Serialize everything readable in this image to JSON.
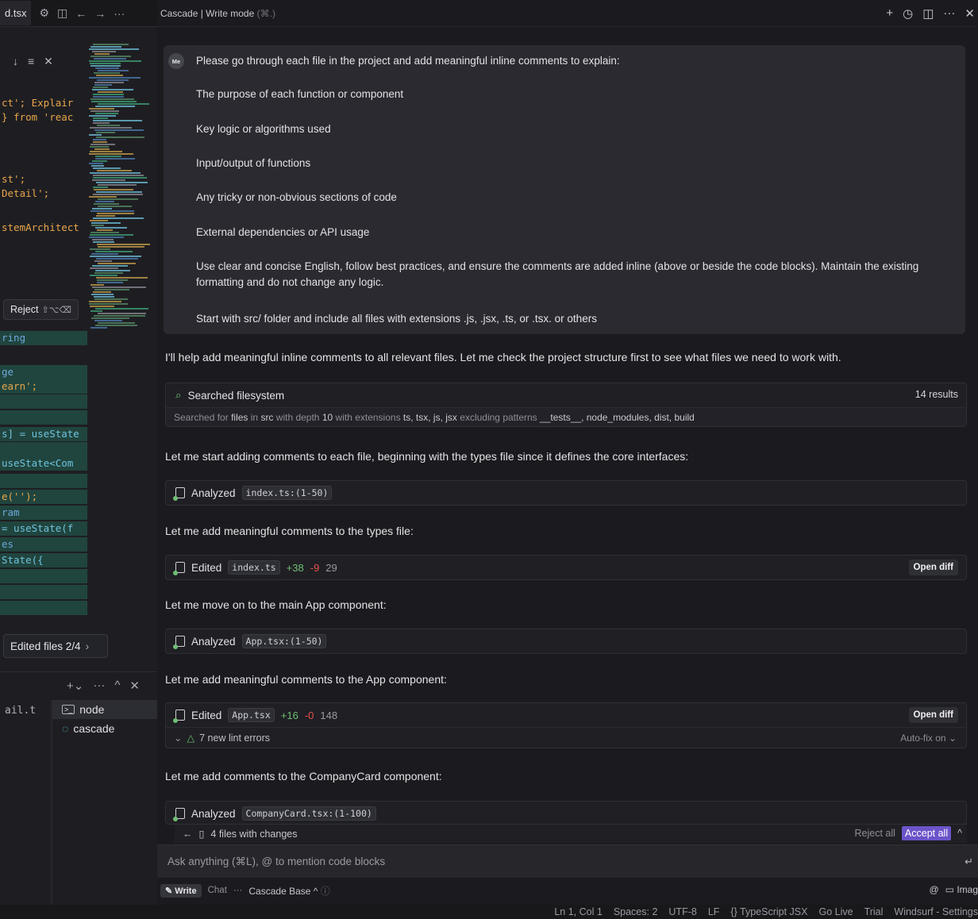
{
  "left_editor": {
    "tab_name": "d.tsx",
    "code_fragments": [
      {
        "text": "ct';  Explair",
        "color": "#e8a64a"
      },
      {
        "text": " } from 'reac",
        "color": "#e8a64a"
      },
      {
        "text": "st';",
        "color": "#e8a64a"
      },
      {
        "text": "Detail';",
        "color": "#e8a64a"
      },
      {
        "text": "stemArchitect",
        "color": "#e8a64a"
      },
      {
        "text": "ring",
        "color": "#6fa8dc"
      },
      {
        "text": "ge",
        "color": "#6fa8dc"
      },
      {
        "text": "earn';",
        "color": "#e8a64a"
      },
      {
        "text": "s] = useState",
        "color": "#6fc3df"
      },
      {
        "text": " useState<Com",
        "color": "#6fc3df"
      },
      {
        "text": "e('');",
        "color": "#e8a64a"
      },
      {
        "text": "ram",
        "color": "#6fa8dc"
      },
      {
        "text": " = useState(f",
        "color": "#6fc3df"
      },
      {
        "text": "es",
        "color": "#6fa8dc"
      },
      {
        "text": "State({",
        "color": "#6fc3df"
      }
    ],
    "reject_label": "Reject",
    "reject_shortcut": "⇧⌥⌫",
    "edited_files_label": "Edited files 2/4",
    "terminal_fragment": "ail.t",
    "terminals": [
      {
        "name": "node",
        "icon": "terminal-icon"
      },
      {
        "name": "cascade",
        "icon": "cascade-icon"
      }
    ]
  },
  "cascade": {
    "title": "Cascade | Write mode",
    "title_shortcut": "(⌘.)",
    "user_message": {
      "avatar": "Me",
      "lines": [
        "Please go through each file in the project and add meaningful inline comments to explain:",
        "The purpose of each function or component",
        "Key logic or algorithms used",
        "Input/output of functions",
        "Any tricky or non-obvious sections of code",
        "External dependencies or API usage",
        "Use clear and concise English, follow best practices, and ensure the comments are added inline (above or beside the code blocks). Maintain the existing formatting and do not change any logic.",
        "Start with src/ folder and include all files with extensions .js, .jsx, .ts, or .tsx. or others"
      ]
    },
    "messages": {
      "intro": "I'll help add meaningful inline comments to all relevant files. Let me check the project structure first to see what files we need to work with.",
      "search_title": "Searched filesystem",
      "search_results": "14 results",
      "search_detail_pre": "Searched for",
      "search_detail_files": "files",
      "search_detail_in": "in",
      "search_detail_src": "src",
      "search_detail_depth": "with depth",
      "search_detail_depth_val": "10",
      "search_detail_ext": "with extensions",
      "search_detail_ext_val": "ts, tsx, js, jsx",
      "search_detail_excl": "excluding patterns",
      "search_detail_excl_val": "__tests__, node_modules, dist, build",
      "m1": "Let me start adding comments to each file, beginning with the types file since it defines the core interfaces:",
      "a1_label": "Analyzed",
      "a1_file": "index.ts:(1-50)",
      "m2": "Let me add meaningful comments to the types file:",
      "e1_label": "Edited",
      "e1_file": "index.ts",
      "e1_plus": "+38",
      "e1_minus": "-9",
      "e1_total": "29",
      "open_diff": "Open diff",
      "m3": "Let me move on to the main App component:",
      "a2_label": "Analyzed",
      "a2_file": "App.tsx:(1-50)",
      "m4": "Let me add meaningful comments to the App component:",
      "e2_label": "Edited",
      "e2_file": "App.tsx",
      "e2_plus": "+16",
      "e2_minus": "-0",
      "e2_total": "148",
      "lint_label": "7 new lint errors",
      "autofix_label": "Auto-fix on",
      "m5": "Let me add comments to the CompanyCard component:",
      "a3_label": "Analyzed",
      "a3_file": "CompanyCard.tsx:(1-100)"
    },
    "changes_bar": {
      "label": "4 files with changes",
      "reject_all": "Reject all",
      "accept_all": "Accept all"
    },
    "input": {
      "placeholder": "Ask anything (⌘L), @ to mention code blocks"
    },
    "mode_row": {
      "write": "Write",
      "chat": "Chat",
      "more": "···",
      "model": "Cascade Base",
      "image_label": "Imag"
    }
  },
  "status_bar": {
    "items": [
      "Ln 1, Col 1",
      "Spaces: 2",
      "UTF-8",
      "LF",
      "{} TypeScript JSX",
      "Go Live",
      "Trial",
      "Windsurf - Settings"
    ]
  }
}
